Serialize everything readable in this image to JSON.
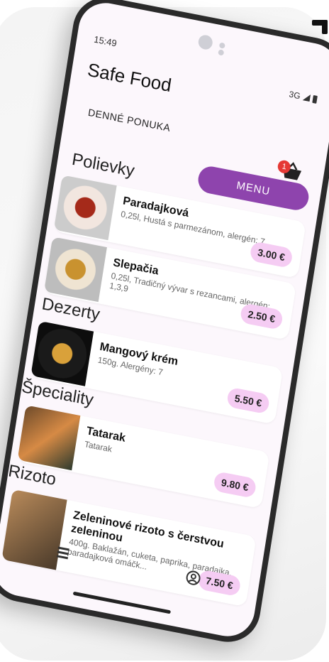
{
  "status": {
    "time": "15:49",
    "network": "3G"
  },
  "app": {
    "title": "Safe Food",
    "subtitle": "DENNÉ PONUKA",
    "menu_label": "MENU",
    "cart_count": "1"
  },
  "sections": {
    "soups": "Polievky",
    "desserts": "Dezerty",
    "specials": "Špeciality",
    "risotto": "Rizoto"
  },
  "items": [
    {
      "name": "Paradajková",
      "desc": "0,25l, Hustá s parmezánom, alergén: 7",
      "price": "3.00 €"
    },
    {
      "name": "Slepačia",
      "desc": "0,25l, Tradičný vývar s rezancami, alergén: 1,3,9",
      "price": "2.50 €"
    },
    {
      "name": "Mangový krém",
      "desc": "150g. Alergény: 7",
      "price": "5.50 €"
    },
    {
      "name": "Tatarak",
      "desc": "Tatarak",
      "price": "9.80 €"
    },
    {
      "name": "Zeleninové rizoto s čerstvou zeleninou",
      "desc": "400g. Baklažán, cuketa, paprika, paradajka, paradajková omáčk...",
      "price": "7.50 €"
    }
  ],
  "colors": {
    "accent": "#8e44ad",
    "price_bg": "#f5ccf3",
    "badge": "#e53935"
  },
  "icons": {
    "nav_left": "list-icon",
    "nav_right": "account-icon",
    "cart": "basket-icon"
  }
}
